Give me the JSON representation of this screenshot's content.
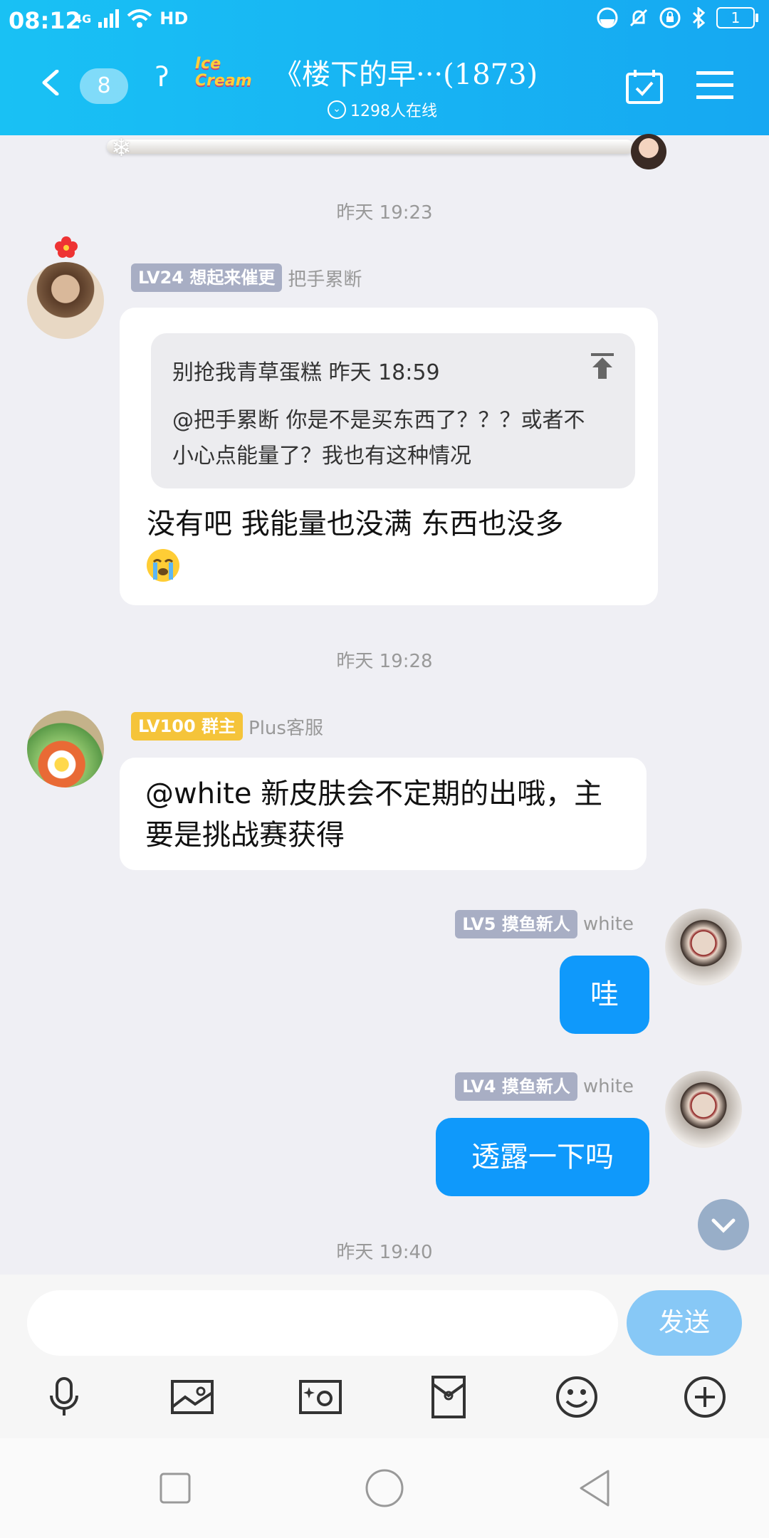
{
  "status_bar": {
    "time": "08:12",
    "network": "4G",
    "hd": "HD",
    "battery": "1"
  },
  "header": {
    "unread_count": "8",
    "logo_text": "Ice Cream",
    "title": "《楼下的早···(1873)",
    "online": "1298人在线"
  },
  "messages": [
    {
      "timestamp": "昨天 19:23",
      "level": "LV24",
      "badge": "想起来催更",
      "nickname": "把手累断",
      "quote_header": "别抢我青草蛋糕 昨天 18:59",
      "quote_body": "@把手累断 你是不是买东西了？？？或者不小心点能量了？我也有这种情况",
      "text": "没有吧 我能量也没满 东西也没多"
    },
    {
      "timestamp": "昨天 19:28",
      "level": "LV100",
      "badge": "群主",
      "nickname": "Plus客服",
      "text": "@white 新皮肤会不定期的出哦，主要是挑战赛获得"
    },
    {
      "level": "LV5",
      "badge": "摸鱼新人",
      "nickname": "white",
      "text": "哇"
    },
    {
      "level": "LV4",
      "badge": "摸鱼新人",
      "nickname": "white",
      "text": "透露一下吗"
    }
  ],
  "last_timestamp": "昨天 19:40",
  "input": {
    "placeholder": "",
    "send_label": "发送"
  },
  "colors": {
    "header": "#16a8f2",
    "my_bubble": "#0f99fb",
    "badge_gray": "#a8aec4",
    "badge_gold": "#f5c43a"
  }
}
